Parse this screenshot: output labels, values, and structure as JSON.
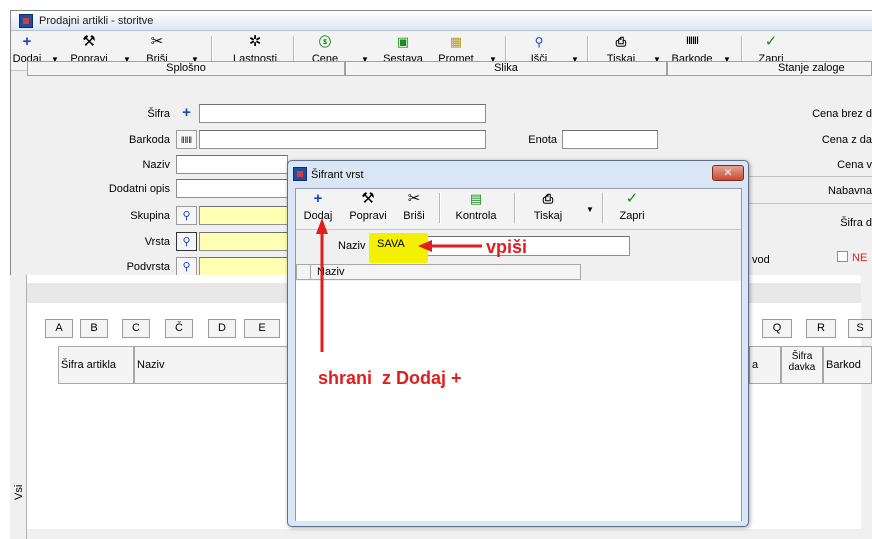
{
  "main_window": {
    "title": "Prodajni artikli - storitve",
    "toolbar": [
      {
        "label": "Dodaj",
        "icon": "+"
      },
      {
        "label": "Popravi",
        "icon": "⚒"
      },
      {
        "label": "Briši",
        "icon": "✂"
      },
      {
        "label": "Lastnosti",
        "icon": "✲"
      },
      {
        "label": "Cene",
        "icon": "$"
      },
      {
        "label": "Sestava",
        "icon": "▣"
      },
      {
        "label": "Promet",
        "icon": "▦"
      },
      {
        "label": "Išči",
        "icon": "⚲"
      },
      {
        "label": "Tiskaj",
        "icon": "⎙"
      },
      {
        "label": "Barkode",
        "icon": "‖‖‖"
      },
      {
        "label": "Zapri",
        "icon": "✓"
      }
    ],
    "section_tabs": [
      "Splošno",
      "Slika",
      "Stanje zaloge"
    ],
    "form": {
      "sifra_label": "Šifra",
      "barkoda_label": "Barkoda",
      "enota_label": "Enota",
      "naziv_label": "Naziv",
      "dodatni_opis_label": "Dodatni opis",
      "skupina_label": "Skupina",
      "vrsta_label": "Vrsta",
      "podvrsta_label": "Podvrsta"
    },
    "right_labels": [
      "Cena brez d",
      "Cena z da",
      "Cena v",
      "Nabavna",
      "Šifra d"
    ],
    "right_check": {
      "prefix": "vod",
      "label": "NE"
    },
    "letter_tabs_left": [
      "A",
      "B",
      "C",
      "Č",
      "D",
      "E"
    ],
    "letter_tabs_right": [
      "Q",
      "R",
      "S"
    ],
    "columns_left": [
      "Šifra artikla",
      "Naziv"
    ],
    "columns_right": [
      "a",
      "Šifra davka",
      "Barkod"
    ],
    "side_tab": "Vsi"
  },
  "dialog": {
    "title": "Šifrant vrst",
    "close_glyph": "✕",
    "toolbar": [
      {
        "label": "Dodaj",
        "icon": "+"
      },
      {
        "label": "Popravi",
        "icon": "⚒"
      },
      {
        "label": "Briši",
        "icon": "✂"
      },
      {
        "label": "Kontrola",
        "icon": "▤"
      },
      {
        "label": "Tiskaj",
        "icon": "⎙"
      },
      {
        "label": "Zapri",
        "icon": "✓"
      }
    ],
    "naziv_label": "Naziv",
    "naziv_value": "SAVA",
    "grid_header": "Naziv"
  },
  "annotations": {
    "vpisi": "vpiši",
    "shrani": "shrani  z Dodaj +",
    "color": "#e01e1e",
    "highlight_color": "#f3f000"
  }
}
